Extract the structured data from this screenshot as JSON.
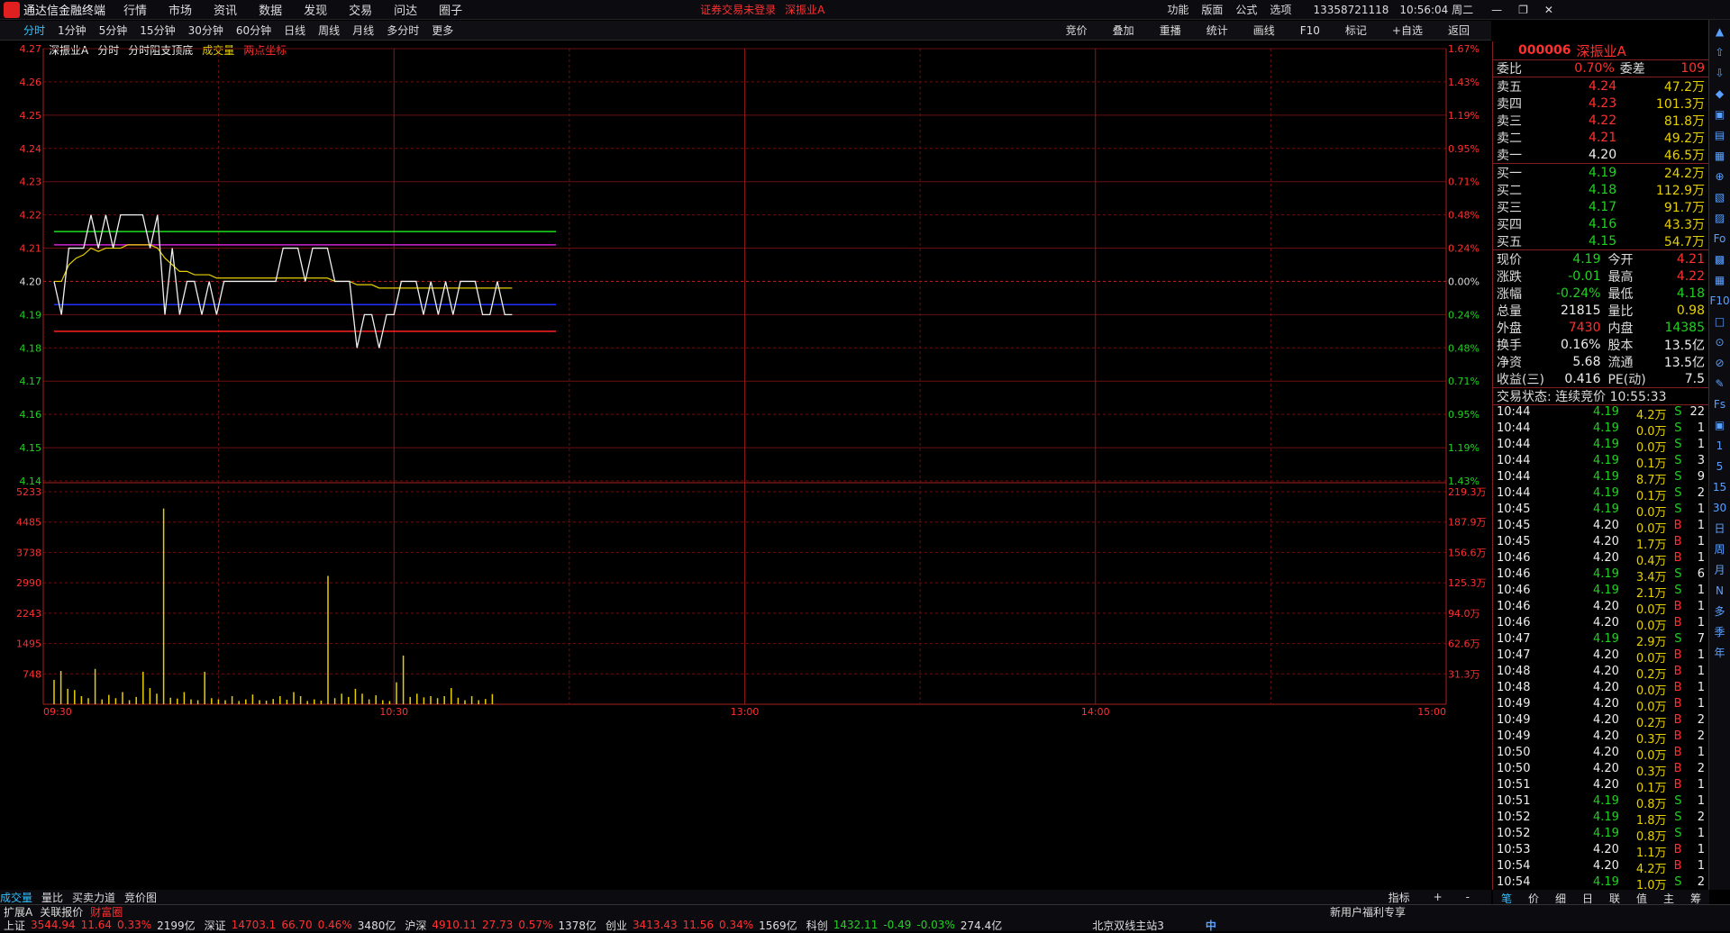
{
  "app": {
    "title": "通达信金融终端",
    "menus": [
      "行情",
      "市场",
      "资讯",
      "数据",
      "发现",
      "交易",
      "问达",
      "圈子"
    ],
    "notice": "证券交易未登录",
    "stock": "深振业A",
    "right_menus": [
      "功能",
      "版面",
      "公式",
      "选项"
    ],
    "phone": "13358721118",
    "clock": "10:56:04 周二"
  },
  "periods": [
    "分时",
    "1分钟",
    "5分钟",
    "15分钟",
    "30分钟",
    "60分钟",
    "日线",
    "周线",
    "月线",
    "多分时",
    "更多"
  ],
  "tools": [
    "竞价",
    "叠加",
    "重播",
    "统计",
    "画线",
    "F10",
    "标记",
    "+自选",
    "返回"
  ],
  "info": {
    "name": "深振业A",
    "a": "分时",
    "b": "分时阻支顶底",
    "c": "成交量",
    "d": "两点坐标"
  },
  "chart_data": {
    "type": "line",
    "price_ticks": [
      "4.27",
      "4.26",
      "4.25",
      "4.24",
      "4.23",
      "4.22",
      "4.21",
      "4.20",
      "4.19",
      "4.18",
      "4.17",
      "4.16",
      "4.15",
      "4.14"
    ],
    "pct_ticks": [
      "1.67%",
      "1.43%",
      "1.19%",
      "0.95%",
      "0.71%",
      "0.48%",
      "0.24%",
      "0.00%",
      "0.24%",
      "0.48%",
      "0.71%",
      "0.95%",
      "1.19%",
      "1.43%"
    ],
    "vol_ticks": [
      "5233",
      "4485",
      "3738",
      "2990",
      "2243",
      "1495",
      "748"
    ],
    "vol_right": [
      "219.3万",
      "187.9万",
      "156.6万",
      "125.3万",
      "94.0万",
      "62.6万",
      "31.3万"
    ],
    "x_ticks": [
      "09:30",
      "10:30",
      "13:00",
      "14:00",
      "15:00"
    ],
    "ylim": [
      4.14,
      4.27
    ],
    "price": [
      4.2,
      4.19,
      4.21,
      4.21,
      4.21,
      4.22,
      4.21,
      4.22,
      4.21,
      4.22,
      4.22,
      4.22,
      4.22,
      4.21,
      4.22,
      4.19,
      4.21,
      4.19,
      4.2,
      4.2,
      4.19,
      4.2,
      4.19,
      4.2,
      4.2,
      4.2,
      4.2,
      4.2,
      4.2,
      4.2,
      4.2,
      4.21,
      4.21,
      4.21,
      4.2,
      4.21,
      4.21,
      4.21,
      4.2,
      4.2,
      4.2,
      4.18,
      4.19,
      4.19,
      4.18,
      4.19,
      4.19,
      4.2,
      4.2,
      4.2,
      4.19,
      4.2,
      4.19,
      4.2,
      4.19,
      4.2,
      4.2,
      4.2,
      4.19,
      4.19,
      4.2,
      4.19,
      4.19
    ],
    "avg": [
      4.2,
      4.2,
      4.205,
      4.207,
      4.208,
      4.21,
      4.209,
      4.21,
      4.21,
      4.21,
      4.211,
      4.211,
      4.211,
      4.211,
      4.21,
      4.207,
      4.205,
      4.203,
      4.203,
      4.202,
      4.202,
      4.202,
      4.201,
      4.201,
      4.201,
      4.201,
      4.201,
      4.201,
      4.201,
      4.201,
      4.201,
      4.201,
      4.201,
      4.201,
      4.201,
      4.201,
      4.201,
      4.201,
      4.2,
      4.2,
      4.2,
      4.199,
      4.199,
      4.199,
      4.198,
      4.198,
      4.198,
      4.198,
      4.198,
      4.198,
      4.198,
      4.198,
      4.198,
      4.198,
      4.198,
      4.198,
      4.198,
      4.198,
      4.198,
      4.198,
      4.198,
      4.198,
      4.198
    ],
    "levels": [
      {
        "value": 4.215,
        "color": "#1ee01e"
      },
      {
        "value": 4.211,
        "color": "#d020d0"
      },
      {
        "value": 4.193,
        "color": "#2030ff"
      },
      {
        "value": 4.185,
        "color": "#ff2020"
      }
    ],
    "volume": [
      600,
      820,
      380,
      350,
      200,
      150,
      870,
      120,
      230,
      150,
      300,
      100,
      180,
      800,
      400,
      260,
      4820,
      160,
      140,
      300,
      120,
      100,
      800,
      150,
      120,
      100,
      200,
      80,
      120,
      240,
      100,
      90,
      130,
      200,
      110,
      300,
      200,
      80,
      120,
      90,
      3160,
      150,
      260,
      180,
      380,
      260,
      120,
      220,
      100,
      80,
      540,
      1200,
      180,
      260,
      170,
      200,
      150,
      200,
      400,
      160,
      100,
      200,
      100,
      130,
      250
    ]
  },
  "quote": {
    "weibi_label": "委比",
    "weibi": "0.70%",
    "weicha_label": "委差",
    "weicha": "109",
    "asks": [
      {
        "label": "卖五",
        "p": "4.24",
        "v": "47.2万"
      },
      {
        "label": "卖四",
        "p": "4.23",
        "v": "101.3万"
      },
      {
        "label": "卖三",
        "p": "4.22",
        "v": "81.8万"
      },
      {
        "label": "卖二",
        "p": "4.21",
        "v": "49.2万"
      },
      {
        "label": "卖一",
        "p": "4.20",
        "v": "46.5万"
      }
    ],
    "bids": [
      {
        "label": "买一",
        "p": "4.19",
        "v": "24.2万"
      },
      {
        "label": "买二",
        "p": "4.18",
        "v": "112.9万"
      },
      {
        "label": "买三",
        "p": "4.17",
        "v": "91.7万"
      },
      {
        "label": "买四",
        "p": "4.16",
        "v": "43.3万"
      },
      {
        "label": "买五",
        "p": "4.15",
        "v": "54.7万"
      }
    ],
    "stats": [
      [
        "现价",
        "4.19",
        "今开",
        "4.21"
      ],
      [
        "涨跌",
        "-0.01",
        "最高",
        "4.22"
      ],
      [
        "涨幅",
        "-0.24%",
        "最低",
        "4.18"
      ],
      [
        "总量",
        "21815",
        "量比",
        "0.98"
      ],
      [
        "外盘",
        "7430",
        "内盘",
        "14385"
      ],
      [
        "换手",
        "0.16%",
        "股本",
        "13.5亿"
      ],
      [
        "净资",
        "5.68",
        "流通",
        "13.5亿"
      ],
      [
        "收益(三)",
        "0.416",
        "PE(动)",
        "7.5"
      ]
    ],
    "state": "交易状态: 连续竞价 10:55:33",
    "code": "000006",
    "name": "深振业A"
  },
  "ticks": [
    [
      "10:44",
      "4.19",
      "4.2万",
      "S",
      "22"
    ],
    [
      "10:44",
      "4.19",
      "0.0万",
      "S",
      "1"
    ],
    [
      "10:44",
      "4.19",
      "0.0万",
      "S",
      "1"
    ],
    [
      "10:44",
      "4.19",
      "0.1万",
      "S",
      "3"
    ],
    [
      "10:44",
      "4.19",
      "8.7万",
      "S",
      "9"
    ],
    [
      "10:44",
      "4.19",
      "0.1万",
      "S",
      "2"
    ],
    [
      "10:45",
      "4.19",
      "0.0万",
      "S",
      "1"
    ],
    [
      "10:45",
      "4.20",
      "0.0万",
      "B",
      "1"
    ],
    [
      "10:45",
      "4.20",
      "1.7万",
      "B",
      "1"
    ],
    [
      "10:46",
      "4.20",
      "0.4万",
      "B",
      "1"
    ],
    [
      "10:46",
      "4.19",
      "3.4万",
      "S",
      "6"
    ],
    [
      "10:46",
      "4.19",
      "2.1万",
      "S",
      "1"
    ],
    [
      "10:46",
      "4.20",
      "0.0万",
      "B",
      "1"
    ],
    [
      "10:46",
      "4.20",
      "0.0万",
      "B",
      "1"
    ],
    [
      "10:47",
      "4.19",
      "2.9万",
      "S",
      "7"
    ],
    [
      "10:47",
      "4.20",
      "0.0万",
      "B",
      "1"
    ],
    [
      "10:48",
      "4.20",
      "0.2万",
      "B",
      "1"
    ],
    [
      "10:48",
      "4.20",
      "0.0万",
      "B",
      "1"
    ],
    [
      "10:49",
      "4.20",
      "0.0万",
      "B",
      "1"
    ],
    [
      "10:49",
      "4.20",
      "0.2万",
      "B",
      "2"
    ],
    [
      "10:49",
      "4.20",
      "0.3万",
      "B",
      "2"
    ],
    [
      "10:50",
      "4.20",
      "0.0万",
      "B",
      "1"
    ],
    [
      "10:50",
      "4.20",
      "0.3万",
      "B",
      "2"
    ],
    [
      "10:51",
      "4.20",
      "0.1万",
      "B",
      "1"
    ],
    [
      "10:51",
      "4.19",
      "0.8万",
      "S",
      "1"
    ],
    [
      "10:52",
      "4.19",
      "1.8万",
      "S",
      "2"
    ],
    [
      "10:52",
      "4.19",
      "0.8万",
      "S",
      "1"
    ],
    [
      "10:53",
      "4.20",
      "1.1万",
      "B",
      "1"
    ],
    [
      "10:54",
      "4.20",
      "4.2万",
      "B",
      "1"
    ],
    [
      "10:54",
      "4.19",
      "1.0万",
      "S",
      "2"
    ]
  ],
  "panel_tabs": [
    "笔",
    "价",
    "细",
    "日",
    "联",
    "值",
    "主",
    "筹"
  ],
  "bottom_tabs": [
    "成交量",
    "量比",
    "买卖力道",
    "竞价图"
  ],
  "bottom_tabs2": [
    "扩展A",
    "关联报价",
    "财富圈"
  ],
  "bottom_right": [
    "指标",
    "+",
    "-"
  ],
  "side_icons": [
    "▲",
    "⇧",
    "⇩",
    "◆",
    "▣",
    "▤",
    "▦",
    "⊕",
    "▧",
    "▨",
    "Fo",
    "▩",
    "▦",
    "F10",
    "□",
    "⊙",
    "⊘",
    "✎",
    "Fs",
    "▣",
    "1",
    "5",
    "15",
    "30",
    "日",
    "周",
    "月",
    "N",
    "多",
    "季",
    "年"
  ],
  "status": {
    "indices": [
      [
        "上证",
        "3544.94",
        "11.64",
        "0.33%",
        "2199亿"
      ],
      [
        "深证",
        "14703.1",
        "66.70",
        "0.46%",
        "3480亿"
      ],
      [
        "沪深",
        "4910.11",
        "27.73",
        "0.57%",
        "1378亿"
      ],
      [
        "创业",
        "3413.43",
        "11.56",
        "0.34%",
        "1569亿"
      ],
      [
        "科创",
        "1432.11",
        "-0.49",
        "-0.03%",
        "274.4亿"
      ]
    ],
    "server": "北京双线主站3",
    "promo": "新用户福利专享",
    "ime": "中"
  },
  "colors": {
    "up": "#ff3030",
    "down": "#21d121",
    "grid": "#6a1010"
  }
}
